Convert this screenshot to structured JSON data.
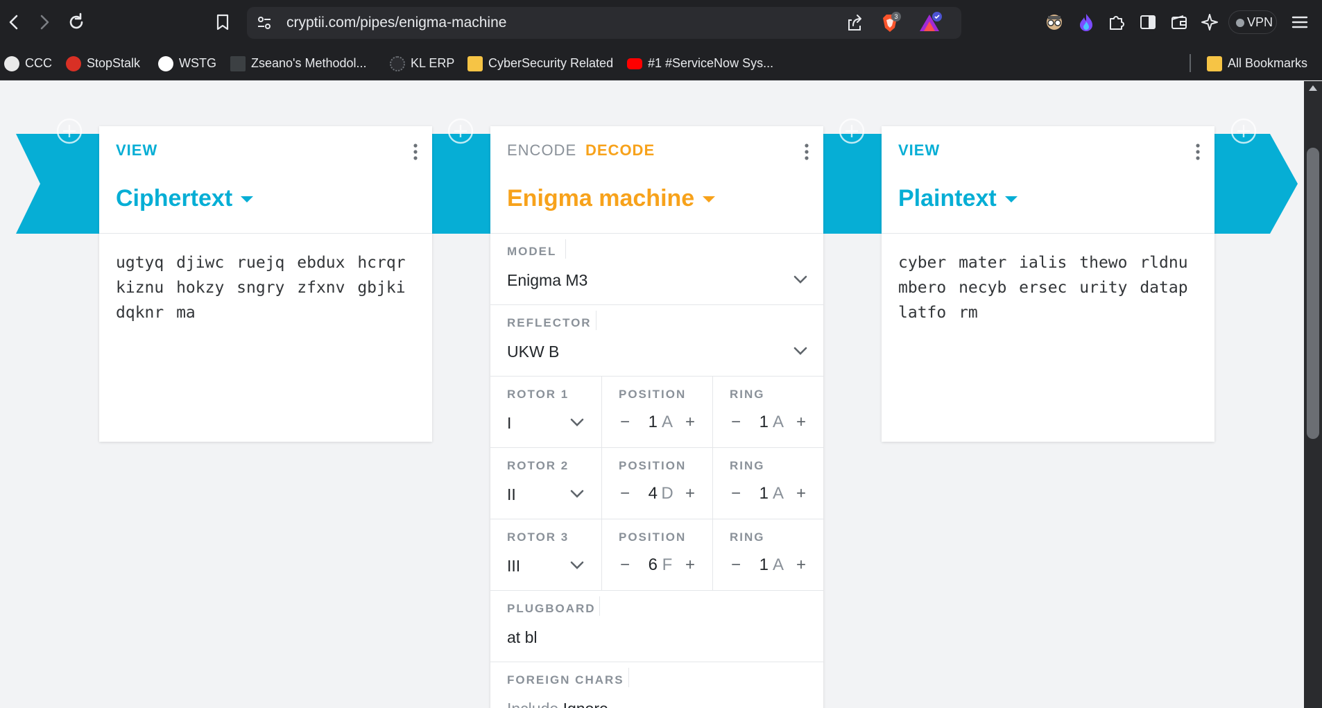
{
  "browser": {
    "url": "cryptii.com/pipes/enigma-machine",
    "shield_count": "3",
    "vpn_label": "VPN"
  },
  "bookmarks": [
    {
      "label": "CCC",
      "icon": "ccc-icon"
    },
    {
      "label": "StopStalk",
      "icon": "stopstalk-icon"
    },
    {
      "label": "WSTG",
      "icon": "wstg-icon"
    },
    {
      "label": "Zseano's Methodol...",
      "icon": "zseano-icon"
    },
    {
      "label": "KL ERP",
      "icon": "kl-erp-icon"
    },
    {
      "label": "CyberSecurity Related",
      "icon": "folder-icon"
    },
    {
      "label": "#1 #ServiceNow Sys...",
      "icon": "youtube-icon"
    },
    {
      "label": "All Bookmarks",
      "icon": "folder-icon"
    }
  ],
  "colors": {
    "accent_blue": "#06aed5",
    "accent_orange": "#f7a21b",
    "muted": "#8a9199"
  },
  "cipher_brick": {
    "tab": "VIEW",
    "title": "Ciphertext",
    "lines": [
      "ugtyq djiwc ruejq ebdux hcrqr",
      "kiznu hokzy sngry zfxnv gbjki",
      "dqknr ma"
    ]
  },
  "enigma_brick": {
    "tab_encode": "ENCODE",
    "tab_decode": "DECODE",
    "title": "Enigma machine",
    "model_label": "MODEL",
    "model_value": "Enigma M3",
    "reflector_label": "REFLECTOR",
    "reflector_value": "UKW B",
    "position_label": "POSITION",
    "ring_label": "RING",
    "rotors": [
      {
        "label": "ROTOR 1",
        "value": "I",
        "position": "1",
        "position_letter": "A",
        "ring": "1",
        "ring_letter": "A"
      },
      {
        "label": "ROTOR 2",
        "value": "II",
        "position": "4",
        "position_letter": "D",
        "ring": "1",
        "ring_letter": "A"
      },
      {
        "label": "ROTOR 3",
        "value": "III",
        "position": "6",
        "position_letter": "F",
        "ring": "1",
        "ring_letter": "A"
      }
    ],
    "plugboard_label": "PLUGBOARD",
    "plugboard_value": "at bl",
    "foreign_label": "FOREIGN CHARS",
    "foreign_include": "Include",
    "foreign_ignore": "Ignore"
  },
  "plain_brick": {
    "tab": "VIEW",
    "title": "Plaintext",
    "lines": [
      "cyber mater ialis thewo rldnu",
      "mbero necyb ersec urity datap",
      "latfo rm"
    ]
  }
}
